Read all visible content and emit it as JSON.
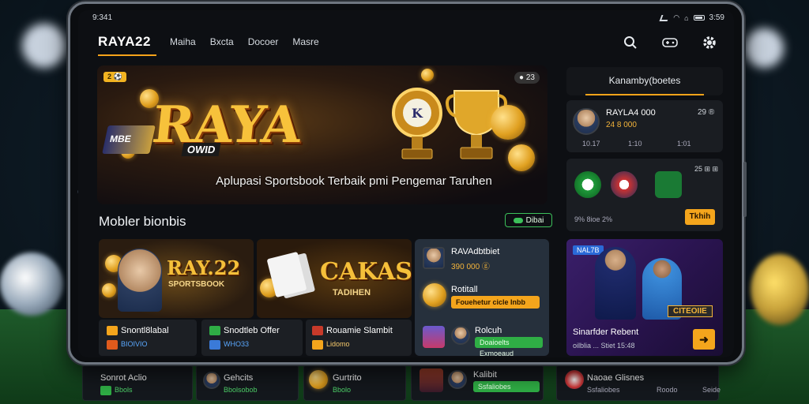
{
  "statusbar": {
    "time": "9:341",
    "right_time": "3:59"
  },
  "header": {
    "brand": "RAYA22",
    "nav": [
      "Maiha",
      "Bxcta",
      "Docoer",
      "Masre"
    ]
  },
  "hero": {
    "badge_left": "2 ⚽",
    "badge_right": "● 23",
    "word": "RAYA",
    "sub_word": "OWID",
    "side_word": "MBE",
    "tagline": "Aplupasi Sportsbook Terbaik pmi Pengemar Taruhen"
  },
  "ranking": {
    "title": "Kanamby(boetes",
    "player_name": "RAYLA4 000",
    "player_score": "24 8 000",
    "player_count": "29 ®",
    "stats": [
      "10.17",
      "1:10",
      "1:01"
    ]
  },
  "teams": {
    "corner": "25 ⊞ ⊞",
    "footer_text": "9% 8ioe 2%",
    "button": "Tkhih"
  },
  "section": {
    "title": "Mobler bionbis",
    "pill": "Dibai"
  },
  "tiles": [
    {
      "title": "RAY.22",
      "subtitle": "SPORTSBOOK",
      "card_label": "Snontl8labal",
      "card_sub": "BIOIVIO"
    },
    {
      "title": "CAKAS",
      "subtitle": "TADIHEN",
      "card_label": "Snodtleb Offer",
      "card_sub": "WHO33",
      "third_label": "Rouamie Slambit",
      "third_sub": "Lidomo"
    }
  ],
  "list": {
    "row1_title": "RAVAdbtbiet",
    "row1_sub": "390 000 ⓖ",
    "row2_title": "Rotitall",
    "row2_bar": "Fouehetur cicle Inbb",
    "row3_title": "Rolcuh",
    "row3_bar": "Doaioelts Exmoeaud"
  },
  "promo2": {
    "badge": "NAL7B",
    "title": "Sinarfder Rebent",
    "sub": "oilblia ... Stiet 15:48",
    "banner": "CITEOIIE"
  },
  "under": [
    {
      "title": "Sonrot Aclio",
      "sub": "Bbols"
    },
    {
      "title": "Gehcits",
      "sub": "Bbolsobob"
    },
    {
      "title": "Gurtrito",
      "sub": "Bbolo"
    },
    {
      "title": "Kalibit",
      "sub": "Ssfaliobes"
    },
    {
      "title": "Naoae Glisnes",
      "sub": "Ssfaliobes",
      "right1": "Roodo",
      "right2": "Seide"
    }
  ],
  "colors": {
    "accent": "#f6a31a",
    "green": "#2fae45",
    "panel": "#1a1d22"
  }
}
